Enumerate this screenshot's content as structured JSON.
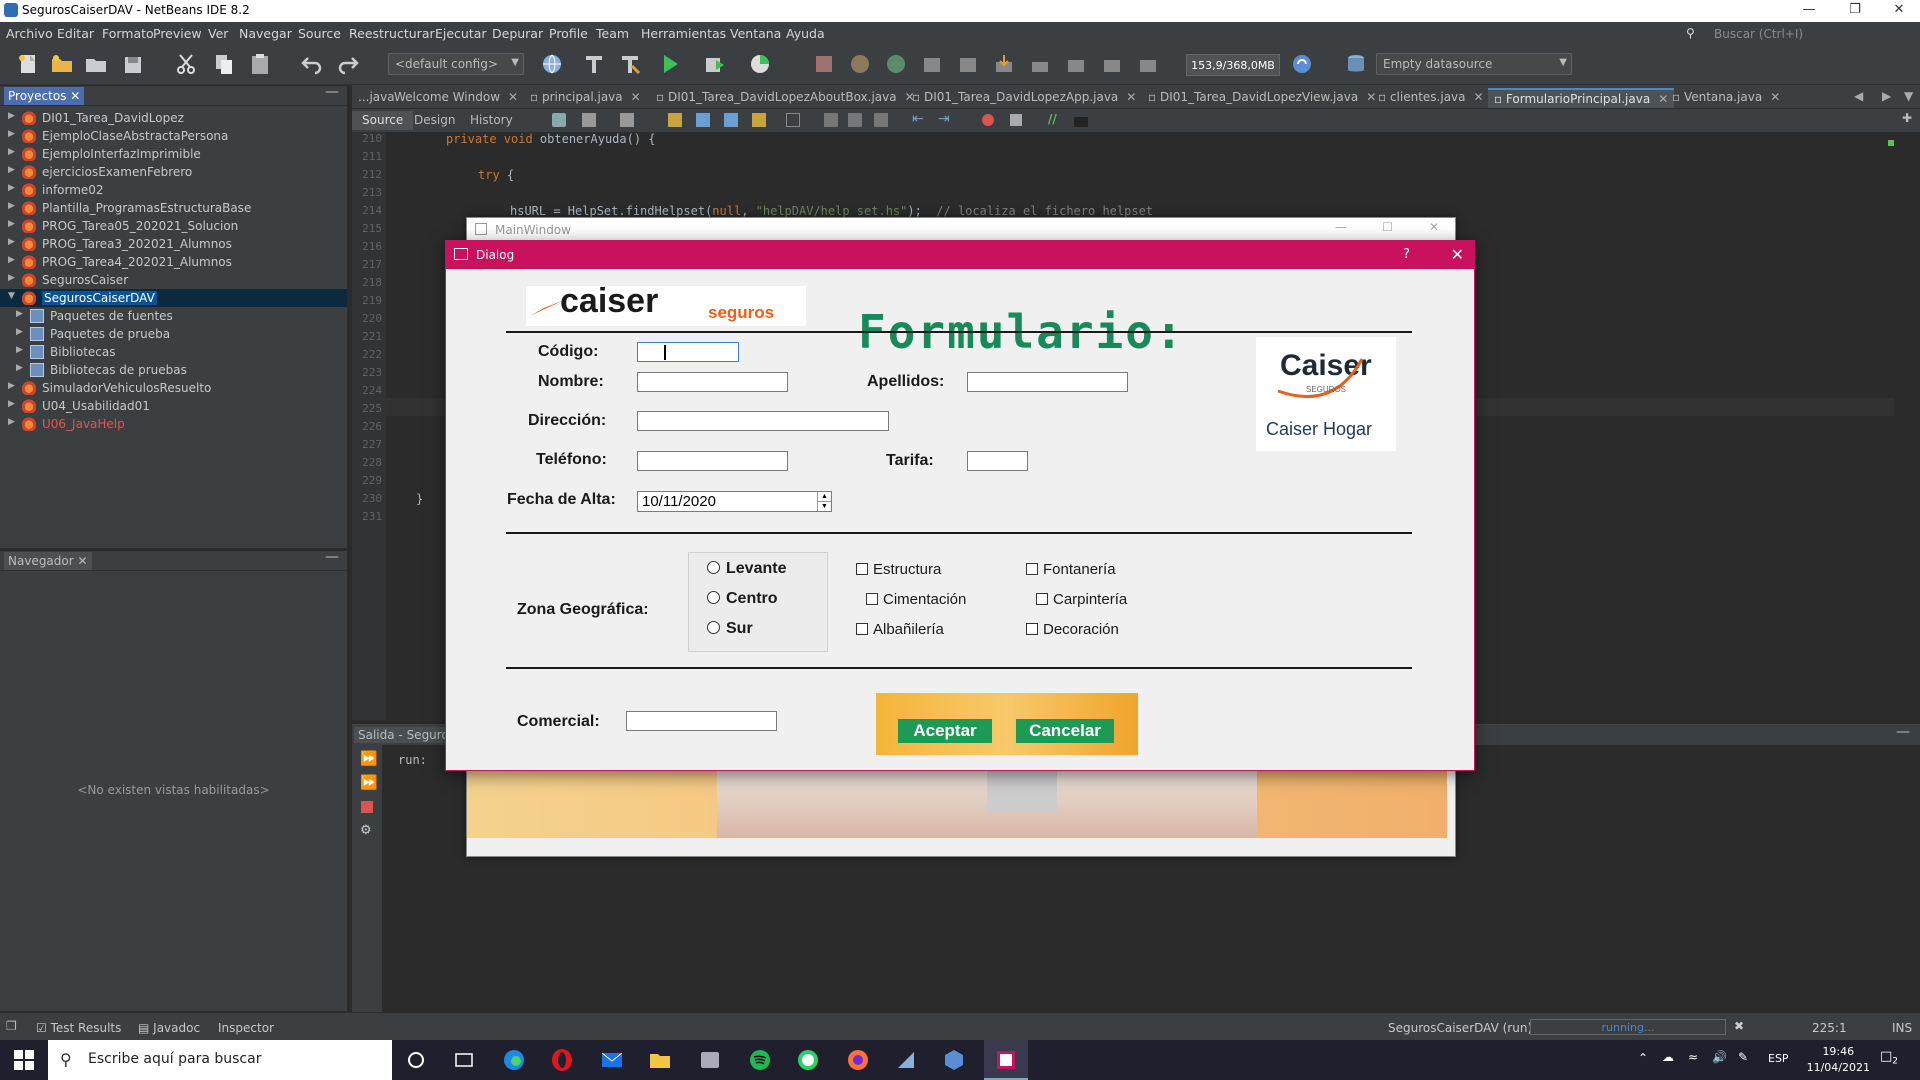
{
  "window": {
    "title": "SegurosCaiserDAV - NetBeans IDE 8.2"
  },
  "menu": [
    "Archivo",
    "Editar",
    "Formato",
    "Preview",
    "Ver",
    "Navegar",
    "Source",
    "Reestructurar",
    "Ejecutar",
    "Depurar",
    "Profile",
    "Team",
    "Herramientas",
    "Ventana",
    "Ayuda"
  ],
  "search": {
    "placeholder": "Buscar (Ctrl+I)"
  },
  "toolbar": {
    "config": "<default config>",
    "memory": "153,9/368,0MB",
    "datasource": "Empty datasource"
  },
  "projects": {
    "title": "Proyectos",
    "items": [
      {
        "label": "DI01_Tarea_DavidLopez"
      },
      {
        "label": "EjemploClaseAbstractaPersona"
      },
      {
        "label": "EjemploInterfazImprimible"
      },
      {
        "label": "ejerciciosExamenFebrero"
      },
      {
        "label": "informe02"
      },
      {
        "label": "Plantilla_ProgramasEstructuraBase"
      },
      {
        "label": "PROG_Tarea05_202021_Solucion"
      },
      {
        "label": "PROG_Tarea3_202021_Alumnos"
      },
      {
        "label": "PROG_Tarea4_202021_Alumnos"
      },
      {
        "label": "SegurosCaiser"
      },
      {
        "label": "SegurosCaiserDAV"
      },
      {
        "label": "Paquetes de fuentes"
      },
      {
        "label": "Paquetes de prueba"
      },
      {
        "label": "Bibliotecas"
      },
      {
        "label": "Bibliotecas de pruebas"
      },
      {
        "label": "SimuladorVehiculosResuelto"
      },
      {
        "label": "U04_Usabilidad01"
      },
      {
        "label": "U06_JavaHelp"
      }
    ]
  },
  "navigator": {
    "title": "Navegador",
    "empty": "<No existen vistas habilitadas>"
  },
  "editor": {
    "tabs": [
      "...java",
      "Welcome Window",
      "principal.java",
      "DI01_Tarea_DavidLopezAboutBox.java",
      "DI01_Tarea_DavidLopezApp.java",
      "DI01_Tarea_DavidLopezView.java",
      "clientes.java",
      "FormularioPrincipal.java",
      "Ventana.java"
    ],
    "views": [
      "Source",
      "Design",
      "History"
    ],
    "line_numbers": [
      "210",
      "211",
      "212",
      "213",
      "214",
      "215",
      "216",
      "217",
      "218",
      "219",
      "220",
      "221",
      "222",
      "223",
      "224",
      "225",
      "226",
      "227",
      "228",
      "229",
      "230",
      "231"
    ],
    "code": {
      "l210_kw": "private void",
      "l210_rest": " obtenerAyuda() {",
      "l212_kw": "try",
      "l212_rest": " {",
      "l214_a": "hsURL = HelpSet.findHelpset(",
      "l214_null": "null",
      "l214_comma": ", ",
      "l214_str": "\"helpDAV/help_set.hs\"",
      "l214_end": ");  ",
      "l214_cmt": "// localiza el fichero helpset",
      "l230": "}"
    }
  },
  "output": {
    "title": "Salida - Seguros",
    "text": "run:"
  },
  "statusbar": {
    "tabs": [
      "Test Results",
      "Javadoc",
      "Inspector"
    ],
    "run": "SegurosCaiserDAV (run)",
    "progress": "running...",
    "position": "225:1",
    "mode": "INS"
  },
  "taskbar": {
    "search": "Escribe aquí para buscar",
    "lang": "ESP",
    "time": "19:46",
    "date": "11/04/2021",
    "notif": "2"
  },
  "mainwindow": {
    "title": "MainWindow"
  },
  "dialog": {
    "title": "Dialog",
    "help": "?",
    "brand": "caiser",
    "brand_sub": "seguros",
    "heading": "Formulario:",
    "logo_name": "Caiser",
    "logo_sub": "SEGUROS",
    "logo_caption": "Caiser Hogar",
    "labels": {
      "codigo": "Código:",
      "nombre": "Nombre:",
      "apellidos": "Apellidos:",
      "direccion": "Dirección:",
      "telefono": "Teléfono:",
      "tarifa": "Tarifa:",
      "fecha": "Fecha de Alta:",
      "zona": "Zona Geográfica:",
      "comercial": "Comercial:"
    },
    "fecha_value": "10/11/2020",
    "zonas": [
      "Levante",
      "Centro",
      "Sur"
    ],
    "checks": [
      "Estructura",
      "Cimentación",
      "Albañilería",
      "Fontanería",
      "Carpintería",
      "Decoración"
    ],
    "accept": "Aceptar",
    "cancel": "Cancelar"
  }
}
